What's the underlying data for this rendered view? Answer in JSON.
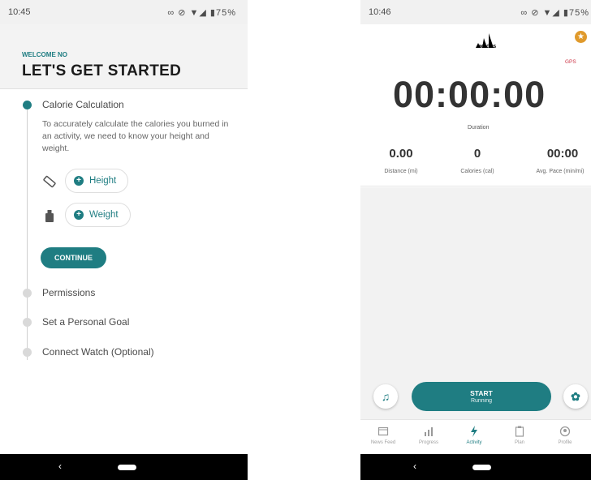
{
  "left_screen": {
    "status_bar": {
      "time": "10:45",
      "icons": "∞ ⊘ ▼◢ ▮75%"
    },
    "header": {
      "welcome": "WELCOME NO",
      "title": "LET'S GET STARTED"
    },
    "steps": [
      {
        "label": "Calorie Calculation",
        "active": true
      },
      {
        "label": "Permissions",
        "active": false
      },
      {
        "label": "Set a Personal Goal",
        "active": false
      },
      {
        "label": "Connect Watch (Optional)",
        "active": false
      }
    ],
    "description": "To accurately calculate the calories you burned in an activity, we need to know your height and weight.",
    "fields": [
      {
        "label": "Height",
        "icon": "ruler-icon"
      },
      {
        "label": "Weight",
        "icon": "weight-icon"
      }
    ],
    "continue_label": "CONTINUE",
    "nav": {
      "back": "‹"
    }
  },
  "right_screen": {
    "status_bar": {
      "time": "10:46",
      "icons": "∞ ⊘ ▼◢ ▮75%"
    },
    "brand": "adidas",
    "gps_label": "GPS",
    "timer": {
      "value": "00:00:00",
      "label": "Duration"
    },
    "metrics": [
      {
        "value": "0.00",
        "label": "Distance (mi)"
      },
      {
        "value": "0",
        "label": "Calories (cal)"
      },
      {
        "value": "00:00",
        "label": "Avg. Pace (min/mi)"
      }
    ],
    "start": {
      "label": "START",
      "sub": "Running"
    },
    "tabs": [
      {
        "label": "News Feed",
        "icon": "news-feed-icon"
      },
      {
        "label": "Progress",
        "icon": "progress-icon"
      },
      {
        "label": "Activity",
        "icon": "activity-icon",
        "active": true
      },
      {
        "label": "Plan",
        "icon": "plan-icon"
      },
      {
        "label": "Profile",
        "icon": "profile-icon"
      }
    ],
    "nav": {
      "back": "‹"
    },
    "colors": {
      "accent": "#1f7d82",
      "badge": "#e09a2c",
      "gps": "#cc3344"
    }
  }
}
